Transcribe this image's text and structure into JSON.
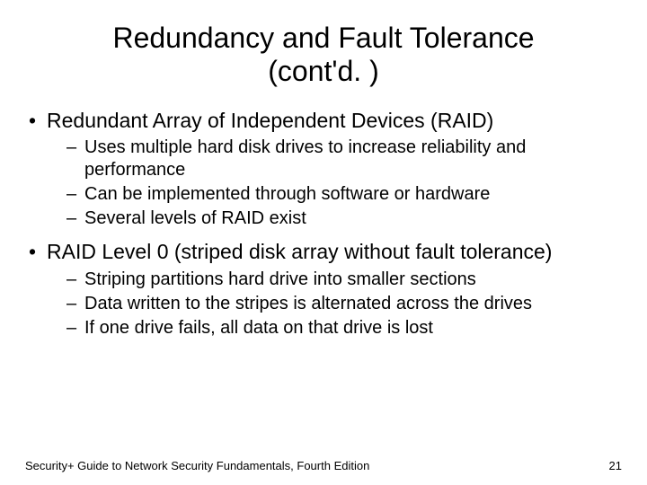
{
  "title_line1": "Redundancy and Fault Tolerance",
  "title_line2": "(cont'd. )",
  "bullets": {
    "b1": "Redundant Array of Independent Devices (RAID)",
    "b1_sub1": "Uses multiple hard disk drives to increase reliability and performance",
    "b1_sub2": "Can be implemented through software or hardware",
    "b1_sub3": "Several levels of RAID exist",
    "b2": "RAID Level 0 (striped disk array without fault tolerance)",
    "b2_sub1": "Striping partitions hard drive into smaller sections",
    "b2_sub2": "Data written to the stripes is alternated across the drives",
    "b2_sub3": "If one drive fails, all data on that drive is lost"
  },
  "footer_left": "Security+ Guide to Network Security Fundamentals, Fourth Edition",
  "footer_right": "21"
}
